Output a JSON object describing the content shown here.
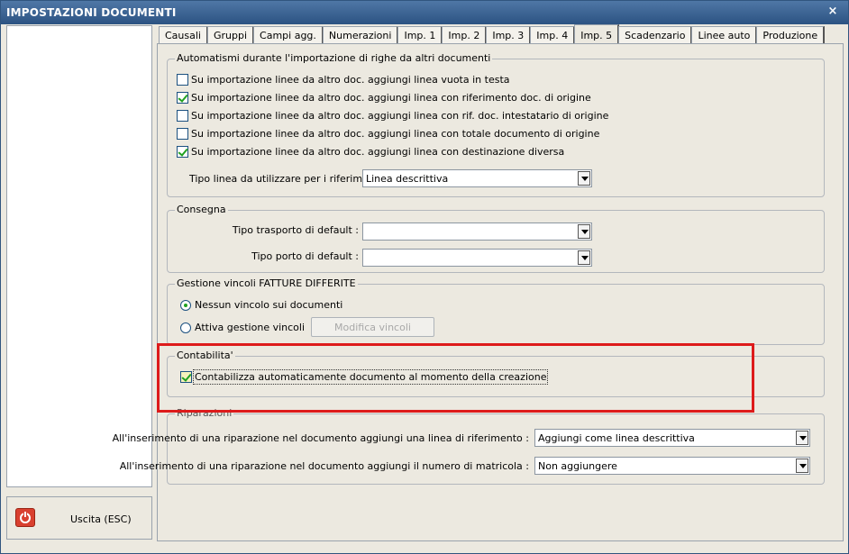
{
  "window": {
    "title": "IMPOSTAZIONI DOCUMENTI",
    "close_symbol": "×"
  },
  "exit": {
    "label": "Uscita (ESC)"
  },
  "tabs": [
    {
      "label": "Causali"
    },
    {
      "label": "Gruppi"
    },
    {
      "label": "Campi agg."
    },
    {
      "label": "Numerazioni"
    },
    {
      "label": "Imp. 1"
    },
    {
      "label": "Imp. 2"
    },
    {
      "label": "Imp. 3"
    },
    {
      "label": "Imp. 4"
    },
    {
      "label": "Imp. 5"
    },
    {
      "label": "Scadenzario"
    },
    {
      "label": "Linee auto"
    },
    {
      "label": "Produzione"
    }
  ],
  "active_tab": "Imp. 5",
  "automatismi": {
    "title": "Automatismi durante l'importazione di righe da altri documenti",
    "options": [
      {
        "label": "Su importazione linee da altro doc. aggiungi linea vuota in testa",
        "checked": false
      },
      {
        "label": "Su importazione linee da altro doc. aggiungi linea con riferimento doc. di origine",
        "checked": true
      },
      {
        "label": "Su importazione linee da altro doc. aggiungi linea con rif. doc. intestatario di origine",
        "checked": false
      },
      {
        "label": "Su importazione linee da altro doc. aggiungi linea con totale documento di origine",
        "checked": false
      },
      {
        "label": "Su importazione linee da altro doc. aggiungi linea con destinazione diversa",
        "checked": true
      }
    ],
    "tipo_linea_label": "Tipo linea da utilizzare per i riferimenti :",
    "tipo_linea_value": "Linea descrittiva"
  },
  "consegna": {
    "title": "Consegna",
    "trasporto_label": "Tipo trasporto di default :",
    "trasporto_value": "",
    "porto_label": "Tipo porto di default :",
    "porto_value": ""
  },
  "vincoli": {
    "title": "Gestione vincoli FATTURE DIFFERITE",
    "option1": "Nessun vincolo sui documenti",
    "option2": "Attiva gestione vincoli",
    "selected": "Nessun vincolo sui documenti",
    "modifica_label": "Modifica vincoli"
  },
  "contabilita": {
    "title": "Contabilita'",
    "option": "Contabilizza automaticamente documento al momento della creazione",
    "checked": true
  },
  "riparazioni": {
    "title": "Riparazioni",
    "rif_label": "All'inserimento di una riparazione nel documento aggiungi una linea di riferimento :",
    "rif_value": "Aggiungi come linea descrittiva",
    "matricola_label": "All'inserimento di una riparazione nel documento aggiungi il numero di matricola :",
    "matricola_value": "Non aggiungere"
  },
  "colors": {
    "title_bar": "#2c5382",
    "highlight": "#dd1b1b",
    "check": "#21a121"
  }
}
